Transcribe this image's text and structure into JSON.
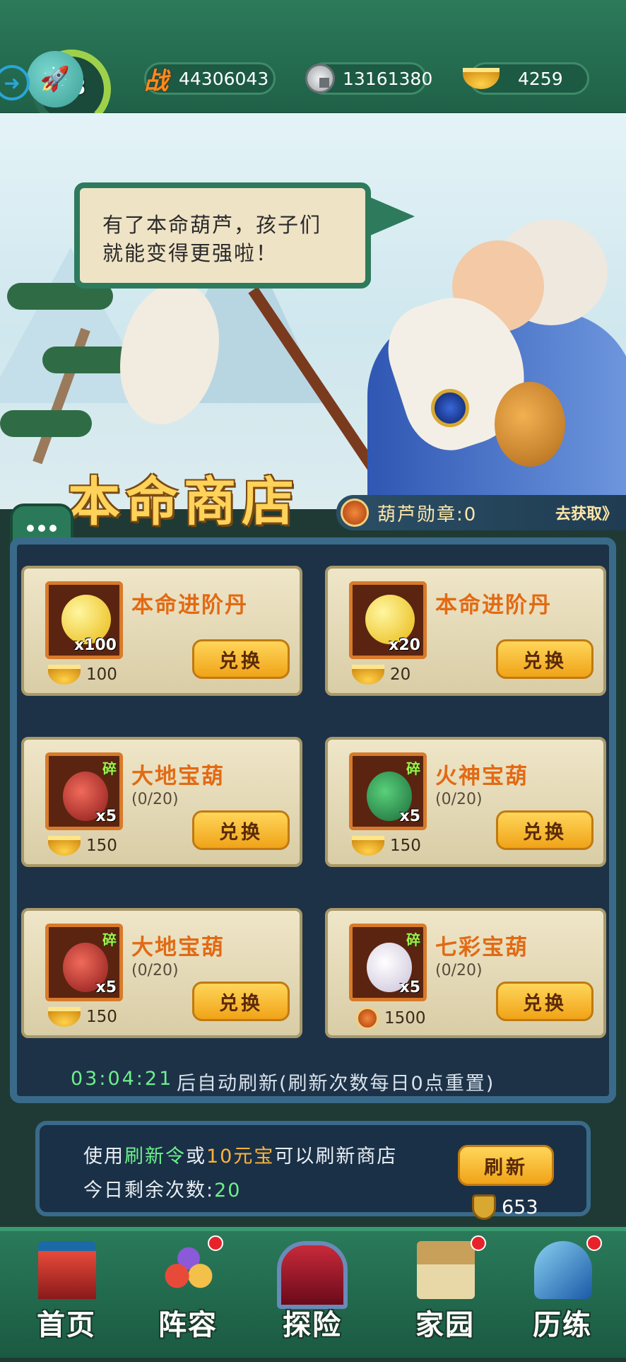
{
  "topbar": {
    "level": "63",
    "power": "44306043",
    "silver": "13161380",
    "gold": "4259"
  },
  "npc": {
    "speech": "有了本命葫芦，孩子们就能变得更强啦！"
  },
  "shop": {
    "title": "本命商店",
    "medal_label": "葫芦勋章:0",
    "medal_go": "去获取》",
    "items": [
      {
        "name": "本命进阶丹",
        "qty": "x100",
        "progress": "",
        "price": "100",
        "currency": "gold",
        "fragment": "",
        "icon": "golden-gourd-icon",
        "button": "兑换"
      },
      {
        "name": "本命进阶丹",
        "qty": "x20",
        "progress": "",
        "price": "20",
        "currency": "gold",
        "fragment": "",
        "icon": "golden-gourd-icon",
        "button": "兑换"
      },
      {
        "name": "大地宝葫",
        "qty": "x5",
        "progress": "(0/20)",
        "price": "150",
        "currency": "gold",
        "fragment": "碎",
        "icon": "earth-gourd-icon",
        "button": "兑换"
      },
      {
        "name": "火神宝葫",
        "qty": "x5",
        "progress": "(0/20)",
        "price": "150",
        "currency": "gold",
        "fragment": "碎",
        "icon": "fire-gourd-icon",
        "button": "兑换"
      },
      {
        "name": "大地宝葫",
        "qty": "x5",
        "progress": "(0/20)",
        "price": "150",
        "currency": "gold",
        "fragment": "碎",
        "icon": "earth-gourd-icon",
        "button": "兑换"
      },
      {
        "name": "七彩宝葫",
        "qty": "x5",
        "progress": "(0/20)",
        "price": "1500",
        "currency": "medal",
        "fragment": "碎",
        "icon": "rainbow-gourd-icon",
        "button": "兑换"
      }
    ],
    "timer": "03:04:21",
    "timer_note": "后自动刷新(刷新次数每日0点重置)"
  },
  "refresh": {
    "line1_a": "使用",
    "line1_b": "刷新令",
    "line1_c": "或",
    "line1_d": "10元宝",
    "line1_e": "可以刷新商店",
    "line2_a": "今日剩余次数:",
    "line2_b": "20",
    "button": "刷新",
    "tokens": "653"
  },
  "nav": [
    {
      "label": "首页",
      "icon": "home-gate-icon",
      "badge": false
    },
    {
      "label": "阵容",
      "icon": "team-gourds-icon",
      "badge": true
    },
    {
      "label": "探险",
      "icon": "adventure-gate-icon",
      "badge": false
    },
    {
      "label": "家园",
      "icon": "homestead-icon",
      "badge": true
    },
    {
      "label": "历练",
      "icon": "training-sword-icon",
      "badge": true
    }
  ]
}
